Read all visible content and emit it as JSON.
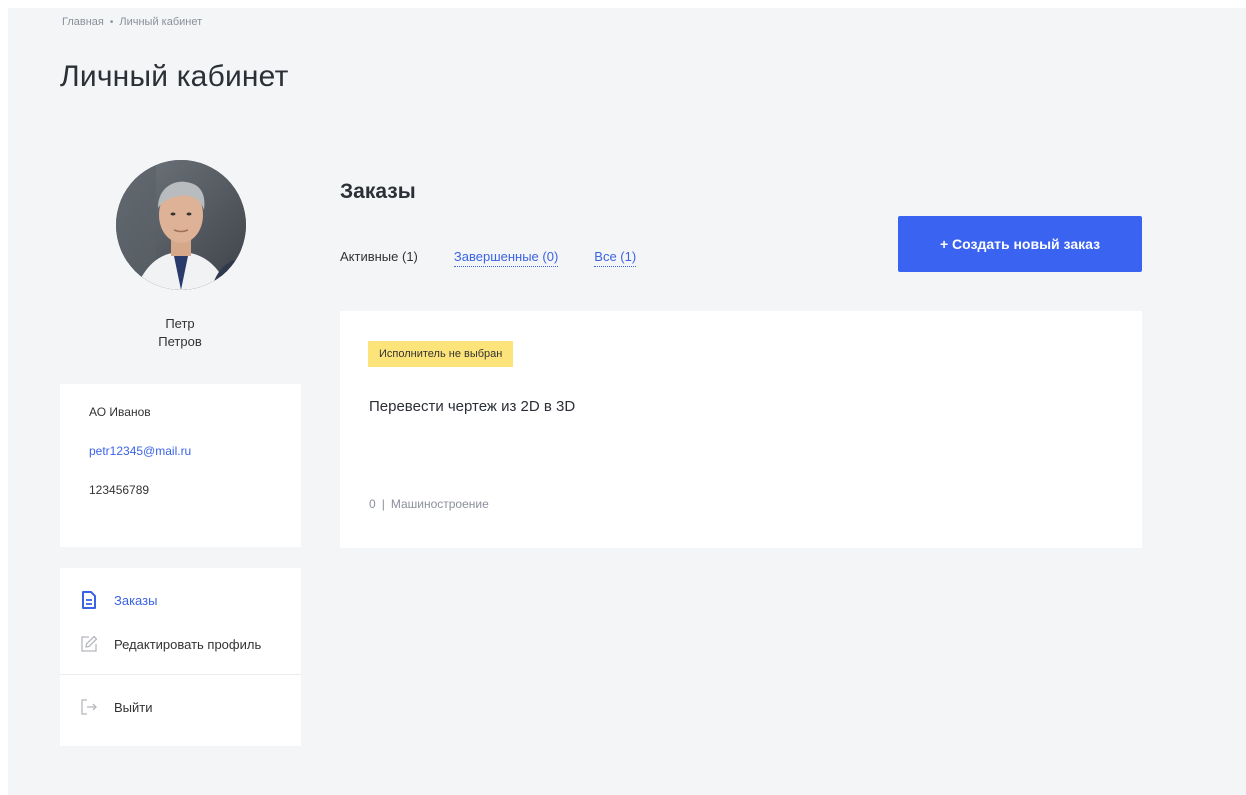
{
  "breadcrumb": {
    "items": [
      "Главная",
      "Личный кабинет"
    ],
    "separator": "•"
  },
  "page_title": "Личный кабинет",
  "user": {
    "first_name": "Петр",
    "last_name": "Петров",
    "company": "АО Иванов",
    "email": "petr12345@mail.ru",
    "phone": "123456789"
  },
  "menu": {
    "orders": {
      "label": "Заказы",
      "icon": "document-icon"
    },
    "edit_profile": {
      "label": "Редактировать профиль",
      "icon": "edit-icon"
    },
    "logout": {
      "label": "Выйти",
      "icon": "logout-icon"
    }
  },
  "orders": {
    "title": "Заказы",
    "tabs": [
      {
        "label": "Активные (1)",
        "active": true
      },
      {
        "label": "Завершенные (0)",
        "active": false
      },
      {
        "label": "Все (1)",
        "active": false
      }
    ],
    "create_button": "+ Создать новый заказ",
    "items": [
      {
        "status": "Исполнитель не выбран",
        "title": "Перевести чертеж из 2D в 3D",
        "count": "0",
        "meta_sep": "|",
        "category": "Машиностроение"
      }
    ]
  },
  "colors": {
    "accent": "#3a63f2",
    "link": "#3b63e6",
    "badge": "#fde47a",
    "background": "#f4f5f7"
  }
}
